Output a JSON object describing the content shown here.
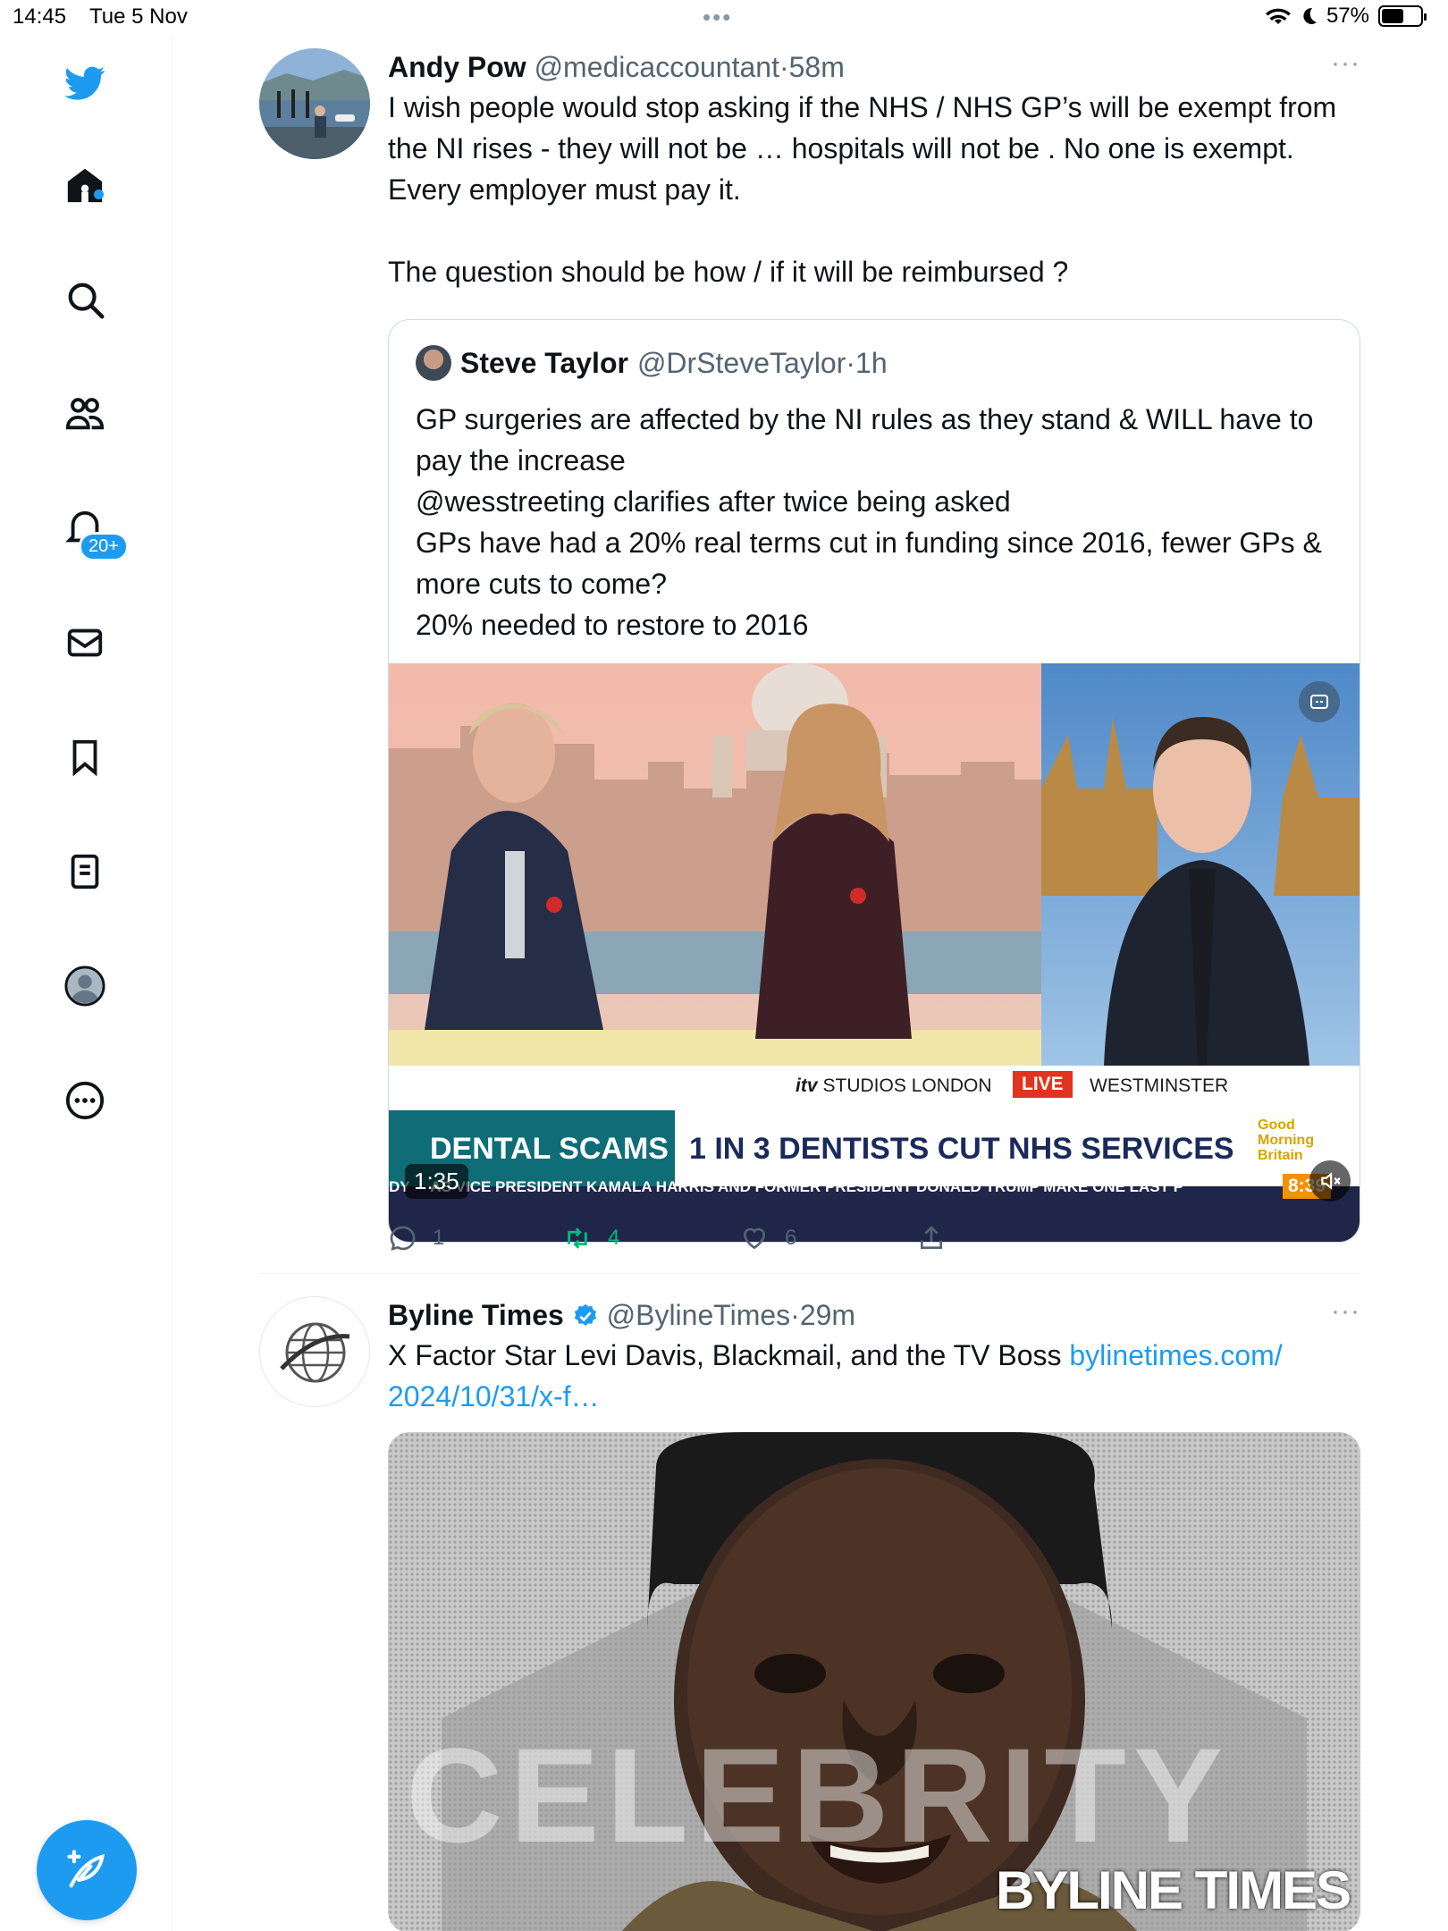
{
  "status_bar": {
    "time": "14:45",
    "date": "Tue 5 Nov",
    "battery": "57%",
    "battery_level": 0.57
  },
  "sidebar": {
    "notifications_badge": "20+",
    "items": [
      "twitter-logo",
      "home-icon",
      "search-icon",
      "communities-icon",
      "notifications-icon",
      "messages-icon",
      "bookmarks-icon",
      "lists-icon",
      "profile-icon",
      "more-icon"
    ]
  },
  "tweets": [
    {
      "name": "Andy Pow",
      "handle": "@medicaccountant",
      "sep": "·",
      "time": "58m",
      "more": "···",
      "text": [
        "I wish people would stop asking if the NHS / NHS GP’s  will be exempt from the NI rises - they will not be … hospitals will not be . No one is exempt. Every employer must pay it.",
        "",
        "The question  should be how / if it  will be reimbursed ?"
      ],
      "quote": {
        "name": "Steve Taylor",
        "handle": "@DrSteveTaylor",
        "sep": "·",
        "time": "1h",
        "text": [
          "GP surgeries are affected by the NI rules as they stand & WILL have to pay the increase",
          "@wesstreeting clarifies after twice being asked",
          "GPs have had a 20% real terms cut in funding since 2016, fewer GPs & more cuts to come?",
          "20% needed to restore to 2016"
        ],
        "video": {
          "location_left": "STUDIOS LONDON",
          "itv_logo": "itv",
          "live": "LIVE",
          "location_right": "WESTMINSTER",
          "headline_tag": "DENTAL SCAMS",
          "headline": "1 IN 3 DENTISTS CUT NHS SERVICES",
          "show_logo": [
            "Good",
            "Morning",
            "Britain"
          ],
          "ticker": "DY     AS VICE PRESIDENT KAMALA HARRIS AND FORMER PRESIDENT DONALD TRUMP MAKE ONE LAST P",
          "clock": "8:39",
          "duration": "1:35"
        }
      },
      "actions": {
        "replies": "1",
        "retweets": "4",
        "likes": "6"
      }
    },
    {
      "name": "Byline Times",
      "handle": "@BylineTimes",
      "sep": "·",
      "time": "29m",
      "more": "···",
      "text_plain": "X Factor Star Levi Davis, Blackmail, and the TV Boss ",
      "link": "bylinetimes.com/\n2024/10/31/x-f…",
      "image_text": "CELEBRITY",
      "image_watermark": "BYLINE TIMES"
    }
  ]
}
